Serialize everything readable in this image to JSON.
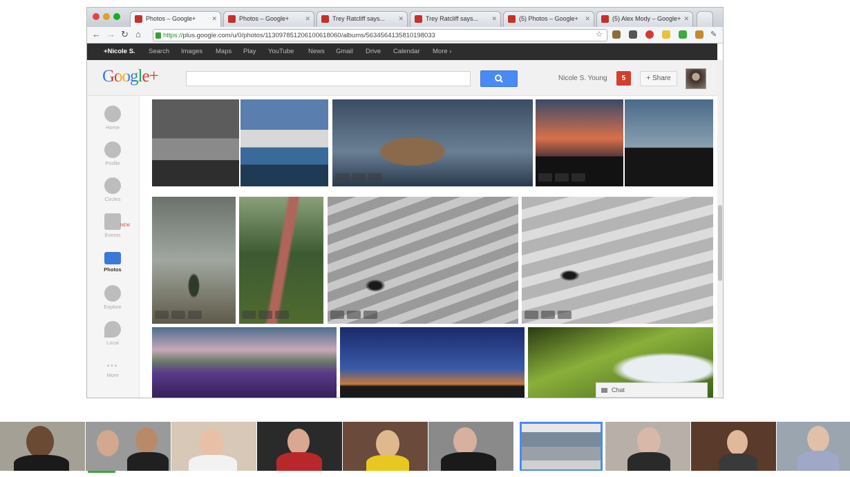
{
  "browser": {
    "tabs": [
      {
        "label": "Photos – Google+",
        "active": true
      },
      {
        "label": "Photos – Google+",
        "active": false
      },
      {
        "label": "Trey Ratcliff says...",
        "active": false
      },
      {
        "label": "Trey Ratcliff says...",
        "active": false
      },
      {
        "label": "(5) Photos – Google+",
        "active": false
      },
      {
        "label": "(5) Alex Mody – Google+",
        "active": false
      }
    ],
    "url_scheme": "https://",
    "url_rest": "plus.google.com/u/0/photos/113097851206100618060/albums/5634564135810198033"
  },
  "gbar": {
    "items": [
      "+Nicole S.",
      "Search",
      "Images",
      "Maps",
      "Play",
      "YouTube",
      "News",
      "Gmail",
      "Drive",
      "Calendar",
      "More ›"
    ]
  },
  "header": {
    "logo_google": "Google",
    "logo_plus": "+",
    "search_placeholder": "",
    "username": "Nicole S. Young",
    "notifications": "5",
    "share_label": "+ Share"
  },
  "sidebar": {
    "items": [
      {
        "label": "Home",
        "icon": "home-icon"
      },
      {
        "label": "Profile",
        "icon": "profile-icon"
      },
      {
        "label": "Circles",
        "icon": "circles-icon"
      },
      {
        "label": "Events",
        "icon": "events-icon"
      },
      {
        "label": "Photos",
        "icon": "photos-icon",
        "active": true
      },
      {
        "label": "Explore",
        "icon": "explore-icon"
      },
      {
        "label": "Local",
        "icon": "local-icon"
      },
      {
        "label": "More",
        "icon": "more-icon"
      }
    ],
    "new_badge": "NEW"
  },
  "chat": {
    "label": "Chat"
  },
  "colors": {
    "accent": "#4a8af4",
    "gbar": "#2d2d2d",
    "notification": "#d23f31"
  }
}
